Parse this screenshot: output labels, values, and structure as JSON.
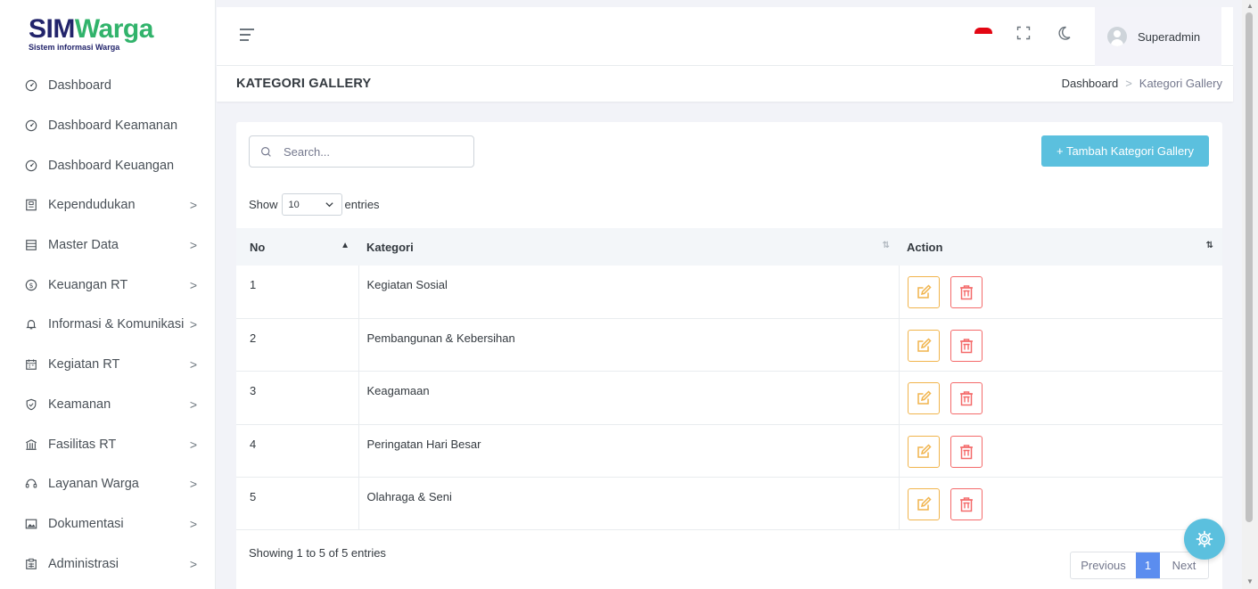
{
  "brand": {
    "logo_sim": "SIM",
    "logo_warga": "Warga",
    "tagline": "Sistem informasi Warga"
  },
  "sidebar": {
    "items": [
      {
        "label": "Dashboard",
        "icon": "gauge-icon",
        "has_children": false
      },
      {
        "label": "Dashboard Keamanan",
        "icon": "gauge-icon",
        "has_children": false
      },
      {
        "label": "Dashboard Keuangan",
        "icon": "gauge-icon",
        "has_children": false
      },
      {
        "label": "Kependudukan",
        "icon": "id-card-icon",
        "has_children": true
      },
      {
        "label": "Master Data",
        "icon": "database-icon",
        "has_children": true
      },
      {
        "label": "Keuangan RT",
        "icon": "dollar-circle-icon",
        "has_children": true
      },
      {
        "label": "Informasi & Komunikasi",
        "icon": "bell-icon",
        "has_children": true
      },
      {
        "label": "Kegiatan RT",
        "icon": "calendar-icon",
        "has_children": true
      },
      {
        "label": "Keamanan",
        "icon": "shield-icon",
        "has_children": true
      },
      {
        "label": "Fasilitas RT",
        "icon": "building-icon",
        "has_children": true
      },
      {
        "label": "Layanan Warga",
        "icon": "headset-icon",
        "has_children": true
      },
      {
        "label": "Dokumentasi",
        "icon": "image-icon",
        "has_children": true
      },
      {
        "label": "Administrasi",
        "icon": "clipboard-icon",
        "has_children": true
      }
    ],
    "chevron": ">"
  },
  "topbar": {
    "user_name": "Superadmin",
    "language": "id"
  },
  "page": {
    "title": "KATEGORI GALLERY",
    "breadcrumb": [
      "Dashboard",
      "Kategori Gallery"
    ],
    "breadcrumb_sep": ">"
  },
  "toolbar": {
    "search_placeholder": "Search...",
    "add_label": "+ Tambah Kategori Gallery",
    "show_label": "Show",
    "page_size": "10",
    "entries_label": "entries"
  },
  "table": {
    "columns": [
      "No",
      "Kategori",
      "Action"
    ],
    "rows": [
      {
        "no": "1",
        "kategori": "Kegiatan Sosial"
      },
      {
        "no": "2",
        "kategori": "Pembangunan & Kebersihan"
      },
      {
        "no": "3",
        "kategori": "Keagamaan"
      },
      {
        "no": "4",
        "kategori": "Peringatan Hari Besar"
      },
      {
        "no": "5",
        "kategori": "Olahraga & Seni"
      }
    ]
  },
  "footer": {
    "info": "Showing 1 to 5 of 5 entries",
    "prev": "Previous",
    "current_page": "1",
    "next": "Next"
  },
  "colors": {
    "accent": "#5bc0de",
    "edit": "#f1b44c",
    "delete": "#f46a6a",
    "active_page": "#5b8def",
    "brand_dark": "#22246b",
    "brand_green": "#31b36b"
  }
}
